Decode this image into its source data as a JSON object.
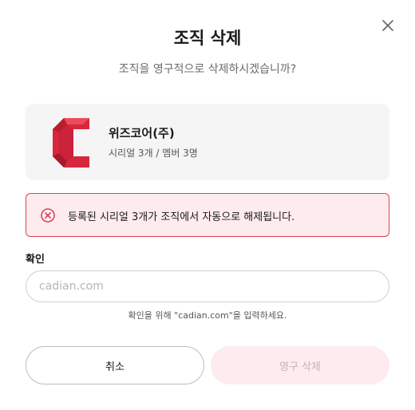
{
  "dialog": {
    "title": "조직 삭제",
    "subtitle": "조직을 영구적으로 삭제하시겠습니까?",
    "close_icon": "close-icon"
  },
  "organization": {
    "name": "위즈코어(주)",
    "meta": "시리얼 3개 / 멤버 3명",
    "logo_color": "#d8283c"
  },
  "alert": {
    "icon": "error-circle-icon",
    "text": "등록된 시리얼 3개가 조직에서 자동으로 해제됩니다.",
    "border_color": "#d9435a",
    "background_color": "#fdebee"
  },
  "confirm": {
    "label": "확인",
    "placeholder": "cadian.com",
    "value": "",
    "hint": "확인을 위해 \"cadian.com\"을 입력하세요."
  },
  "buttons": {
    "cancel_label": "취소",
    "delete_label": "영구 삭제"
  }
}
